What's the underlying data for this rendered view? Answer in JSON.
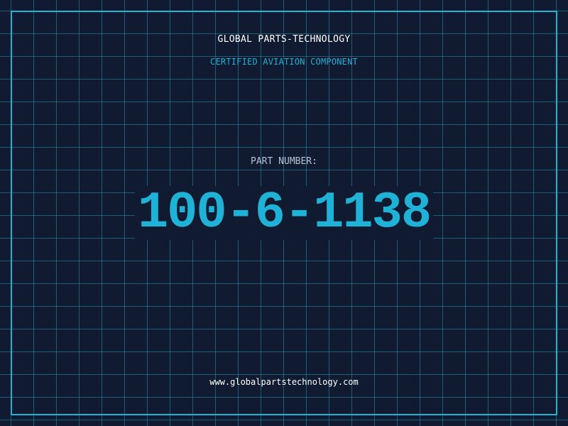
{
  "header": {
    "brand": "GLOBAL PARTS-TECHNOLOGY",
    "tagline": "CERTIFIED AVIATION COMPONENT"
  },
  "part": {
    "label": "PART NUMBER:",
    "number": "100-6-1138"
  },
  "footer": {
    "url": "www.globalpartstechnology.com"
  },
  "colors": {
    "background": "#101a30",
    "accent": "#1fb1d6",
    "grid": "#2896aa",
    "text": "#ffffff",
    "muted": "#b7c3d3"
  }
}
